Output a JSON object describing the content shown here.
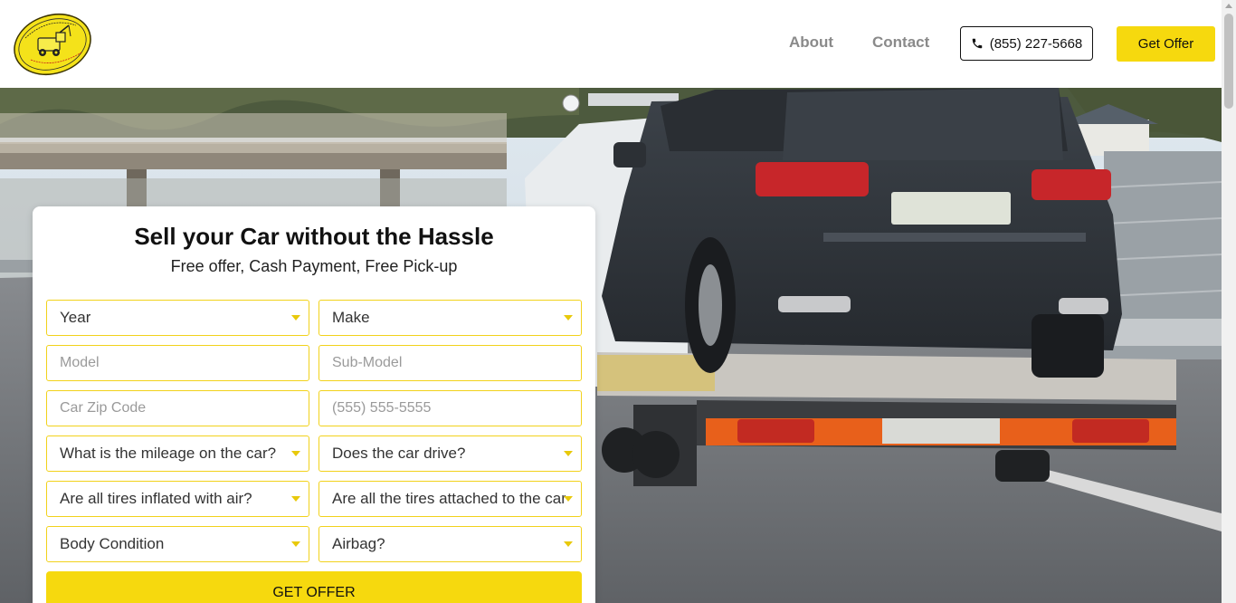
{
  "header": {
    "nav": {
      "about": "About",
      "contact": "Contact"
    },
    "phone": "(855) 227-5668",
    "offer_button": "Get Offer"
  },
  "logo": {
    "icon": "tow-truck-lemon-logo"
  },
  "form": {
    "title": "Sell your Car without the Hassle",
    "subtitle": "Free offer, Cash Payment, Free Pick-up",
    "year_select": "Year",
    "make_select": "Make",
    "model_placeholder": "Model",
    "submodel_placeholder": "Sub-Model",
    "zip_placeholder": "Car Zip Code",
    "phone_placeholder": "(555) 555-5555",
    "mileage_select": "What is the mileage on the car?",
    "drive_select": "Does the car drive?",
    "tires_inflated_select": "Are all tires inflated with air?",
    "tires_attached_select": "Are all the tires attached to the car?",
    "body_condition_select": "Body Condition",
    "airbag_select": "Airbag?",
    "submit": "GET OFFER"
  },
  "colors": {
    "accent": "#f6d90e",
    "field_border": "#f2d21b",
    "nav_text": "#8a8a8a"
  }
}
